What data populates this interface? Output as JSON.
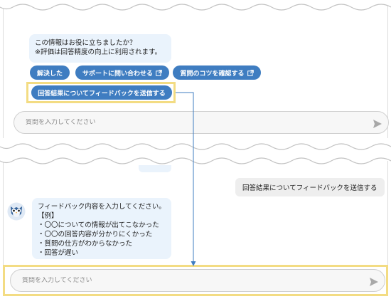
{
  "top": {
    "prompt_lines": [
      "この情報はお役に立ちましたか？",
      "※評価は回答精度の向上に利用されます。"
    ],
    "buttons": {
      "resolved": "解決した",
      "contact_support": "サポートに問い合わせる",
      "question_tips": "質問のコツを確認する",
      "send_feedback": "回答結果についてフィードバックを送信する"
    },
    "input_placeholder": "質問を入力してください"
  },
  "bottom": {
    "user_message": "回答結果についてフィードバックを送信する",
    "bot_lines": [
      "フィードバック内容を入力してください。",
      "【例】",
      "・〇〇についての情報が出てこなかった",
      "・〇〇の回答内容が分かりにくかった",
      "・質問の仕方がわからなかった",
      "・回答が遅い"
    ],
    "input_placeholder": "質問を入力してください"
  },
  "icons": {
    "external_link": "external-link-icon",
    "send": "send-icon",
    "avatar": "owl-avatar-icon"
  },
  "colors": {
    "button": "#3f7dc1",
    "bubble": "#eaf3fc",
    "highlight": "#f3dc83",
    "connector": "#3f7dc1"
  }
}
